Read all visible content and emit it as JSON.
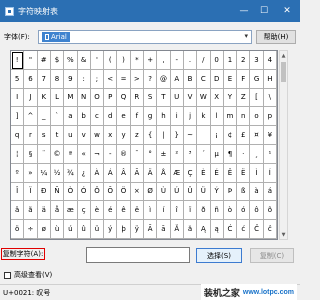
{
  "window": {
    "title": "字符映射表",
    "controls": {
      "minimize": "—",
      "maximize": "☐",
      "close": "✕"
    }
  },
  "font": {
    "label": "字体(F):",
    "value": "Arial",
    "help_label": "帮助(H)"
  },
  "grid": {
    "selected_index": 0,
    "rows": [
      [
        "!",
        "\"",
        "#",
        "$",
        "%",
        "&",
        "'",
        "(",
        ")",
        "*",
        "+",
        ",",
        "-",
        ".",
        "/",
        "0",
        "1",
        "2",
        "3",
        "4"
      ],
      [
        "5",
        "6",
        "7",
        "8",
        "9",
        ":",
        ";",
        "<",
        "=",
        ">",
        "?",
        "@",
        "A",
        "B",
        "C",
        "D",
        "E",
        "F",
        "G",
        "H"
      ],
      [
        "I",
        "J",
        "K",
        "L",
        "M",
        "N",
        "O",
        "P",
        "Q",
        "R",
        "S",
        "T",
        "U",
        "V",
        "W",
        "X",
        "Y",
        "Z",
        "[",
        "\\"
      ],
      [
        "]",
        "^",
        "_",
        "`",
        "a",
        "b",
        "c",
        "d",
        "e",
        "f",
        "g",
        "h",
        "i",
        "j",
        "k",
        "l",
        "m",
        "n",
        "o",
        "p"
      ],
      [
        "q",
        "r",
        "s",
        "t",
        "u",
        "v",
        "w",
        "x",
        "y",
        "z",
        "{",
        "|",
        "}",
        "~",
        "",
        "¡",
        "¢",
        "£",
        "¤",
        "¥"
      ],
      [
        "¦",
        "§",
        "¨",
        "©",
        "ª",
        "«",
        "¬",
        "-",
        "®",
        "¯",
        "°",
        "±",
        "²",
        "³",
        "´",
        "µ",
        "¶",
        "·",
        "¸",
        "¹"
      ],
      [
        "º",
        "»",
        "¼",
        "½",
        "¾",
        "¿",
        "À",
        "Á",
        "Â",
        "Ã",
        "Ä",
        "Å",
        "Æ",
        "Ç",
        "È",
        "É",
        "Ê",
        "Ë",
        "Ì",
        "Í"
      ],
      [
        "Î",
        "Ï",
        "Ð",
        "Ñ",
        "Ò",
        "Ó",
        "Ô",
        "Õ",
        "Ö",
        "×",
        "Ø",
        "Ù",
        "Ú",
        "Û",
        "Ü",
        "Ý",
        "Þ",
        "ß",
        "à",
        "á"
      ],
      [
        "â",
        "ã",
        "ä",
        "å",
        "æ",
        "ç",
        "è",
        "é",
        "ê",
        "ë",
        "ì",
        "í",
        "î",
        "ï",
        "ð",
        "ñ",
        "ò",
        "ó",
        "ô",
        "õ"
      ],
      [
        "ö",
        "÷",
        "ø",
        "ù",
        "ú",
        "û",
        "ü",
        "ý",
        "þ",
        "ÿ",
        "Ā",
        "ā",
        "Ă",
        "ă",
        "Ą",
        "ą",
        "Ć",
        "ć",
        "Ĉ",
        "ĉ"
      ]
    ]
  },
  "copy": {
    "label": "复制字符(A):",
    "value": "",
    "select_label": "选择(S)",
    "copy_label": "复制(C)"
  },
  "advanced": {
    "label": "高级查看(V)",
    "checked": false
  },
  "status": {
    "text": "U+0021: 叹号"
  },
  "watermark": {
    "text": "装机之家",
    "url": "www.lotpc.com"
  },
  "colors": {
    "titlebar": "#2b6fb3",
    "highlight": "#e00000",
    "accent": "#3d7bd0"
  }
}
